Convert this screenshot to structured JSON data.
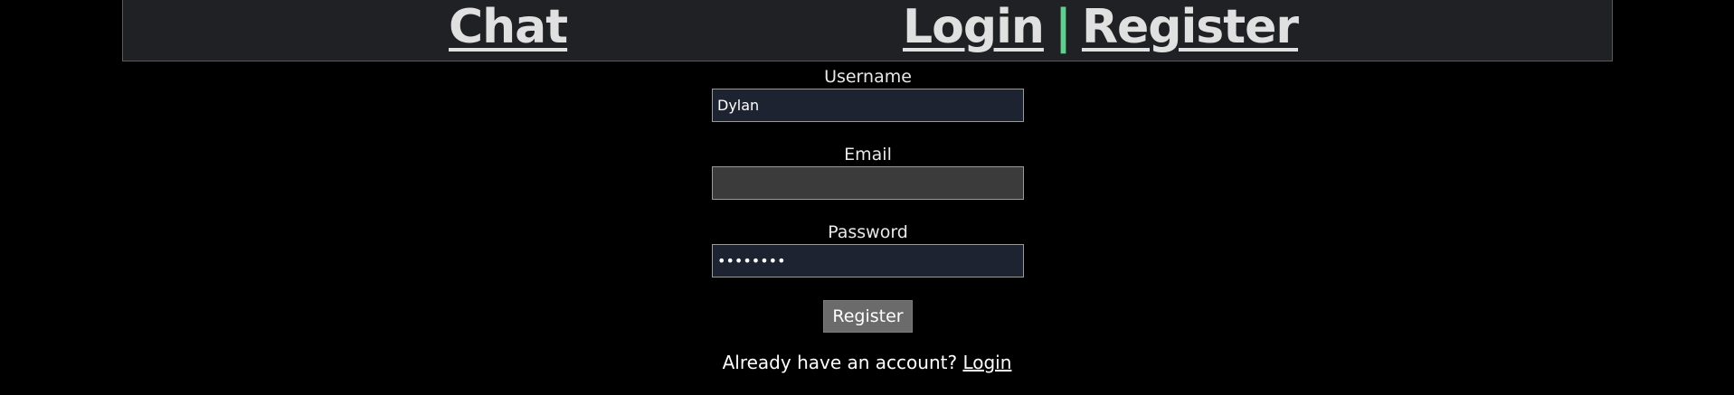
{
  "header": {
    "brand": "Chat",
    "nav_login": "Login",
    "nav_separator": "|",
    "nav_register": "Register"
  },
  "form": {
    "username_label": "Username",
    "username_value": "Dylan",
    "email_label": "Email",
    "email_value": "",
    "password_label": "Password",
    "password_value": "12345678",
    "submit_label": "Register"
  },
  "footer": {
    "prompt": "Already have an account?",
    "login_link": "Login"
  },
  "colors": {
    "page_background": "#000000",
    "header_background": "#202124",
    "separator_accent": "#5fcf8f",
    "input_background": "#1e2331",
    "empty_input_background": "#3b3b3b",
    "button_background": "#6b6b6b"
  }
}
